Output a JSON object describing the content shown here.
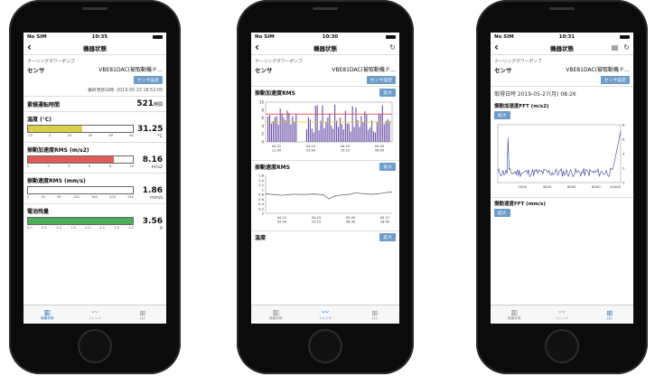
{
  "phone1": {
    "status": {
      "carrier": "No SIM",
      "time": "10:35"
    },
    "nav_title": "機器状態",
    "subtitle": "クーリングタワーポンプ",
    "sensor_label": "センサ",
    "sensor_value": "VBE81DAC(被取動機ド…",
    "settings_button": "センサ設定",
    "updated": "最終更新日時: 2019-05-23 18:52:05",
    "runtime": {
      "label": "累積運転時間",
      "value": "521",
      "unit": "時間"
    },
    "temperature": {
      "label": "温度 (°C)",
      "value": "31.25",
      "unit": "°C",
      "fill": 0.52,
      "color": "#d9d04a",
      "ticks": [
        "-20",
        "0",
        "20",
        "40",
        "60",
        "80"
      ]
    },
    "vib_accel": {
      "label": "振動加速度RMS (m/s2)",
      "value": "8.16",
      "unit": "m/s2",
      "fill": 0.82,
      "color": "#e05a5a",
      "ticks": [
        "0",
        "2",
        "4",
        "6",
        "8",
        "10"
      ]
    },
    "vib_vel": {
      "label": "振動速度RMS (mm/s)",
      "value": "1.86",
      "unit": "mm/s",
      "fill": 0.0,
      "color": "#cccccc",
      "ticks": [
        "0",
        "40",
        "80",
        "120",
        "160",
        "200",
        "240"
      ]
    },
    "battery": {
      "label": "電池残量",
      "value": "3.56",
      "unit": "V",
      "fill": 1.0,
      "color": "#4fae5a",
      "ticks": [
        "0.0",
        "0.5",
        "1.0",
        "1.5",
        "2.0",
        "2.5",
        "3.0",
        "3.5"
      ]
    },
    "tabs": [
      {
        "label": "機器状態",
        "icon": "bar-chart-icon"
      },
      {
        "label": "トレンド",
        "icon": "trend-icon"
      },
      {
        "label": "FFT",
        "icon": "fft-icon"
      }
    ]
  },
  "phone2": {
    "status": {
      "carrier": "No SIM",
      "time": "10:30"
    },
    "nav_title": "機器状態",
    "subtitle": "クーリングタワーポンプ",
    "sensor_label": "センサ",
    "sensor_value": "VBE81DAC(被取動機ド…",
    "settings_button": "センサ設定",
    "sections": [
      {
        "label": "振動加速度RMS",
        "button": "拡大"
      },
      {
        "label": "振動速度RMS",
        "button": "拡大"
      },
      {
        "label": "温度",
        "button": "拡大"
      }
    ],
    "chart_data": [
      {
        "type": "bar",
        "title": "振動加速度RMS",
        "yticks": [
          "10",
          "8",
          "6",
          "4",
          "2",
          "0"
        ],
        "xticks": [
          "03-31\n11:00",
          "04-12\n01:00",
          "04-23\n15:15",
          "05-05\n06:00"
        ],
        "ylim": [
          0,
          10
        ],
        "thresholds": [
          {
            "value": 7.0,
            "color": "#d64b4b"
          },
          {
            "value": 5.0,
            "color": "#d8c53a"
          }
        ]
      },
      {
        "type": "line",
        "title": "振動速度RMS",
        "yticks": [
          "1.6",
          "1.4",
          "1.2",
          "1",
          "0.8",
          "0.6",
          "0.4",
          "0.2",
          "0"
        ],
        "xticks": [
          "04-12\n02:00",
          "04-23\n15:15",
          "05-05\n08:30",
          "05-17\n18:45"
        ],
        "ylim": [
          0,
          1.6
        ],
        "values": [
          0.82,
          0.8,
          0.78,
          0.76,
          0.78,
          0.8,
          0.8,
          0.79,
          0.8,
          0.81,
          0.8,
          0.78,
          0.6,
          0.72,
          0.76,
          0.78,
          0.8,
          0.86,
          0.84,
          0.82,
          0.8,
          0.82,
          0.84,
          0.88,
          0.9
        ]
      }
    ],
    "tabs": [
      {
        "label": "機器状態",
        "icon": "bar-chart-icon"
      },
      {
        "label": "トレンド",
        "icon": "trend-icon"
      },
      {
        "label": "FFT",
        "icon": "fft-icon"
      }
    ]
  },
  "phone3": {
    "status": {
      "carrier": "No SIM",
      "time": "10:31"
    },
    "nav_title": "機器状態",
    "subtitle": "クーリングタワーポンプ",
    "sensor_label": "センサ",
    "sensor_value": "VBE81DAC(被取動機ド…",
    "settings_button": "センサ設定",
    "acquired": "取得日時 2019-05-27(月) 08:26",
    "sections": [
      {
        "label": "振動加速度FFT (m/s2)",
        "button": "拡大"
      },
      {
        "label": "振動速度FFT (mm/s)",
        "button": "拡大"
      }
    ],
    "chart_data": {
      "type": "line",
      "title": "振動加速度FFT (m/s2)",
      "xticks": [
        "2000",
        "4000",
        "6000",
        "8000",
        "10000"
      ],
      "yticks": [
        "8",
        "6",
        "4",
        "2",
        "0"
      ],
      "xlim": [
        0,
        10000
      ],
      "ylim": [
        0,
        8
      ]
    },
    "tabs": [
      {
        "label": "機器状態",
        "icon": "bar-chart-icon"
      },
      {
        "label": "トレンド",
        "icon": "trend-icon"
      },
      {
        "label": "FFT",
        "icon": "fft-icon"
      }
    ]
  }
}
